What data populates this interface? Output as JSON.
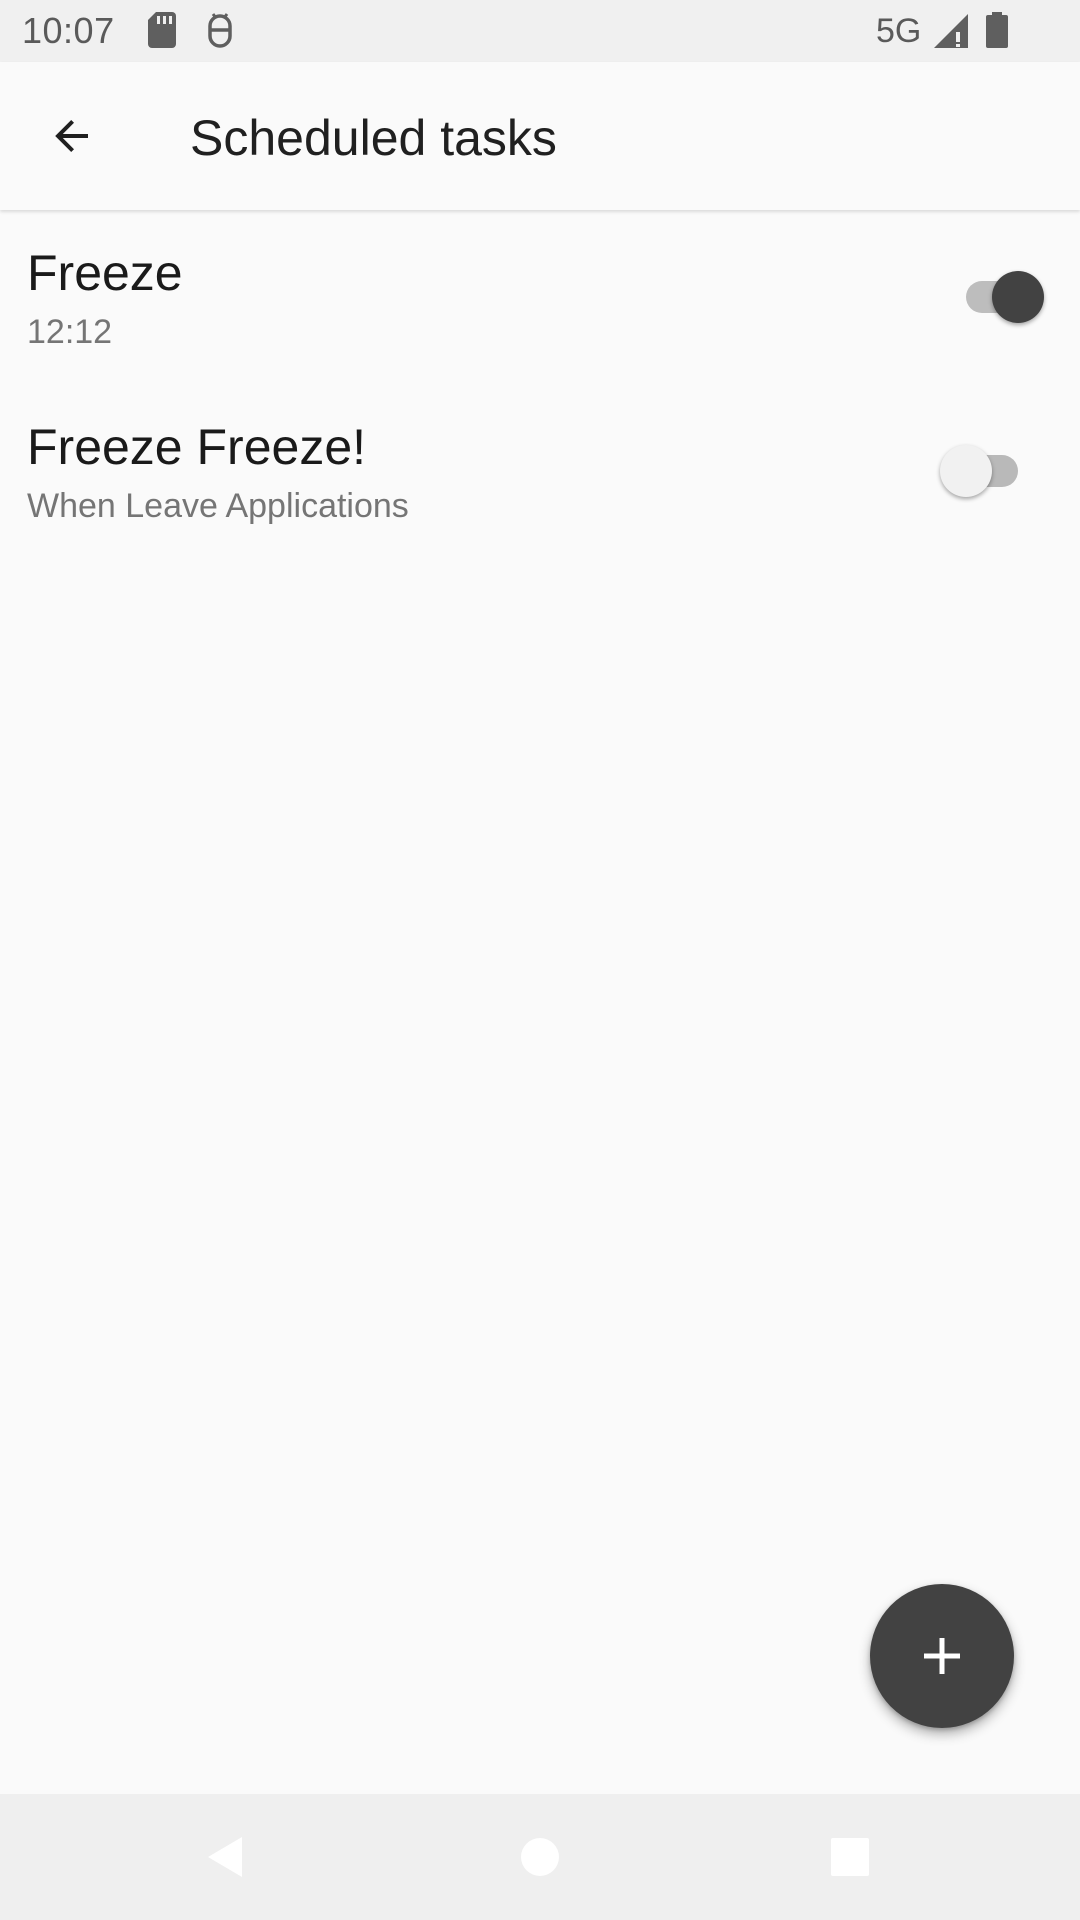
{
  "status_bar": {
    "time": "10:07",
    "network": "5G",
    "icons": [
      "sd-card-icon",
      "android-debug-icon",
      "signal-icon",
      "battery-icon"
    ]
  },
  "app_bar": {
    "title": "Scheduled tasks",
    "back_icon": "arrow-back-icon"
  },
  "tasks": [
    {
      "title": "Freeze",
      "subtitle": "12:12",
      "enabled": true
    },
    {
      "title": "Freeze Freeze!",
      "subtitle": "When Leave Applications",
      "enabled": false
    }
  ],
  "fab": {
    "icon": "plus-icon"
  },
  "nav_bar": {
    "icons": [
      "nav-back-icon",
      "nav-home-icon",
      "nav-recents-icon"
    ]
  },
  "colors": {
    "background": "#fafafa",
    "primary_dark": "#424242",
    "text_primary": "#1a1a1a",
    "text_secondary": "#757575"
  }
}
